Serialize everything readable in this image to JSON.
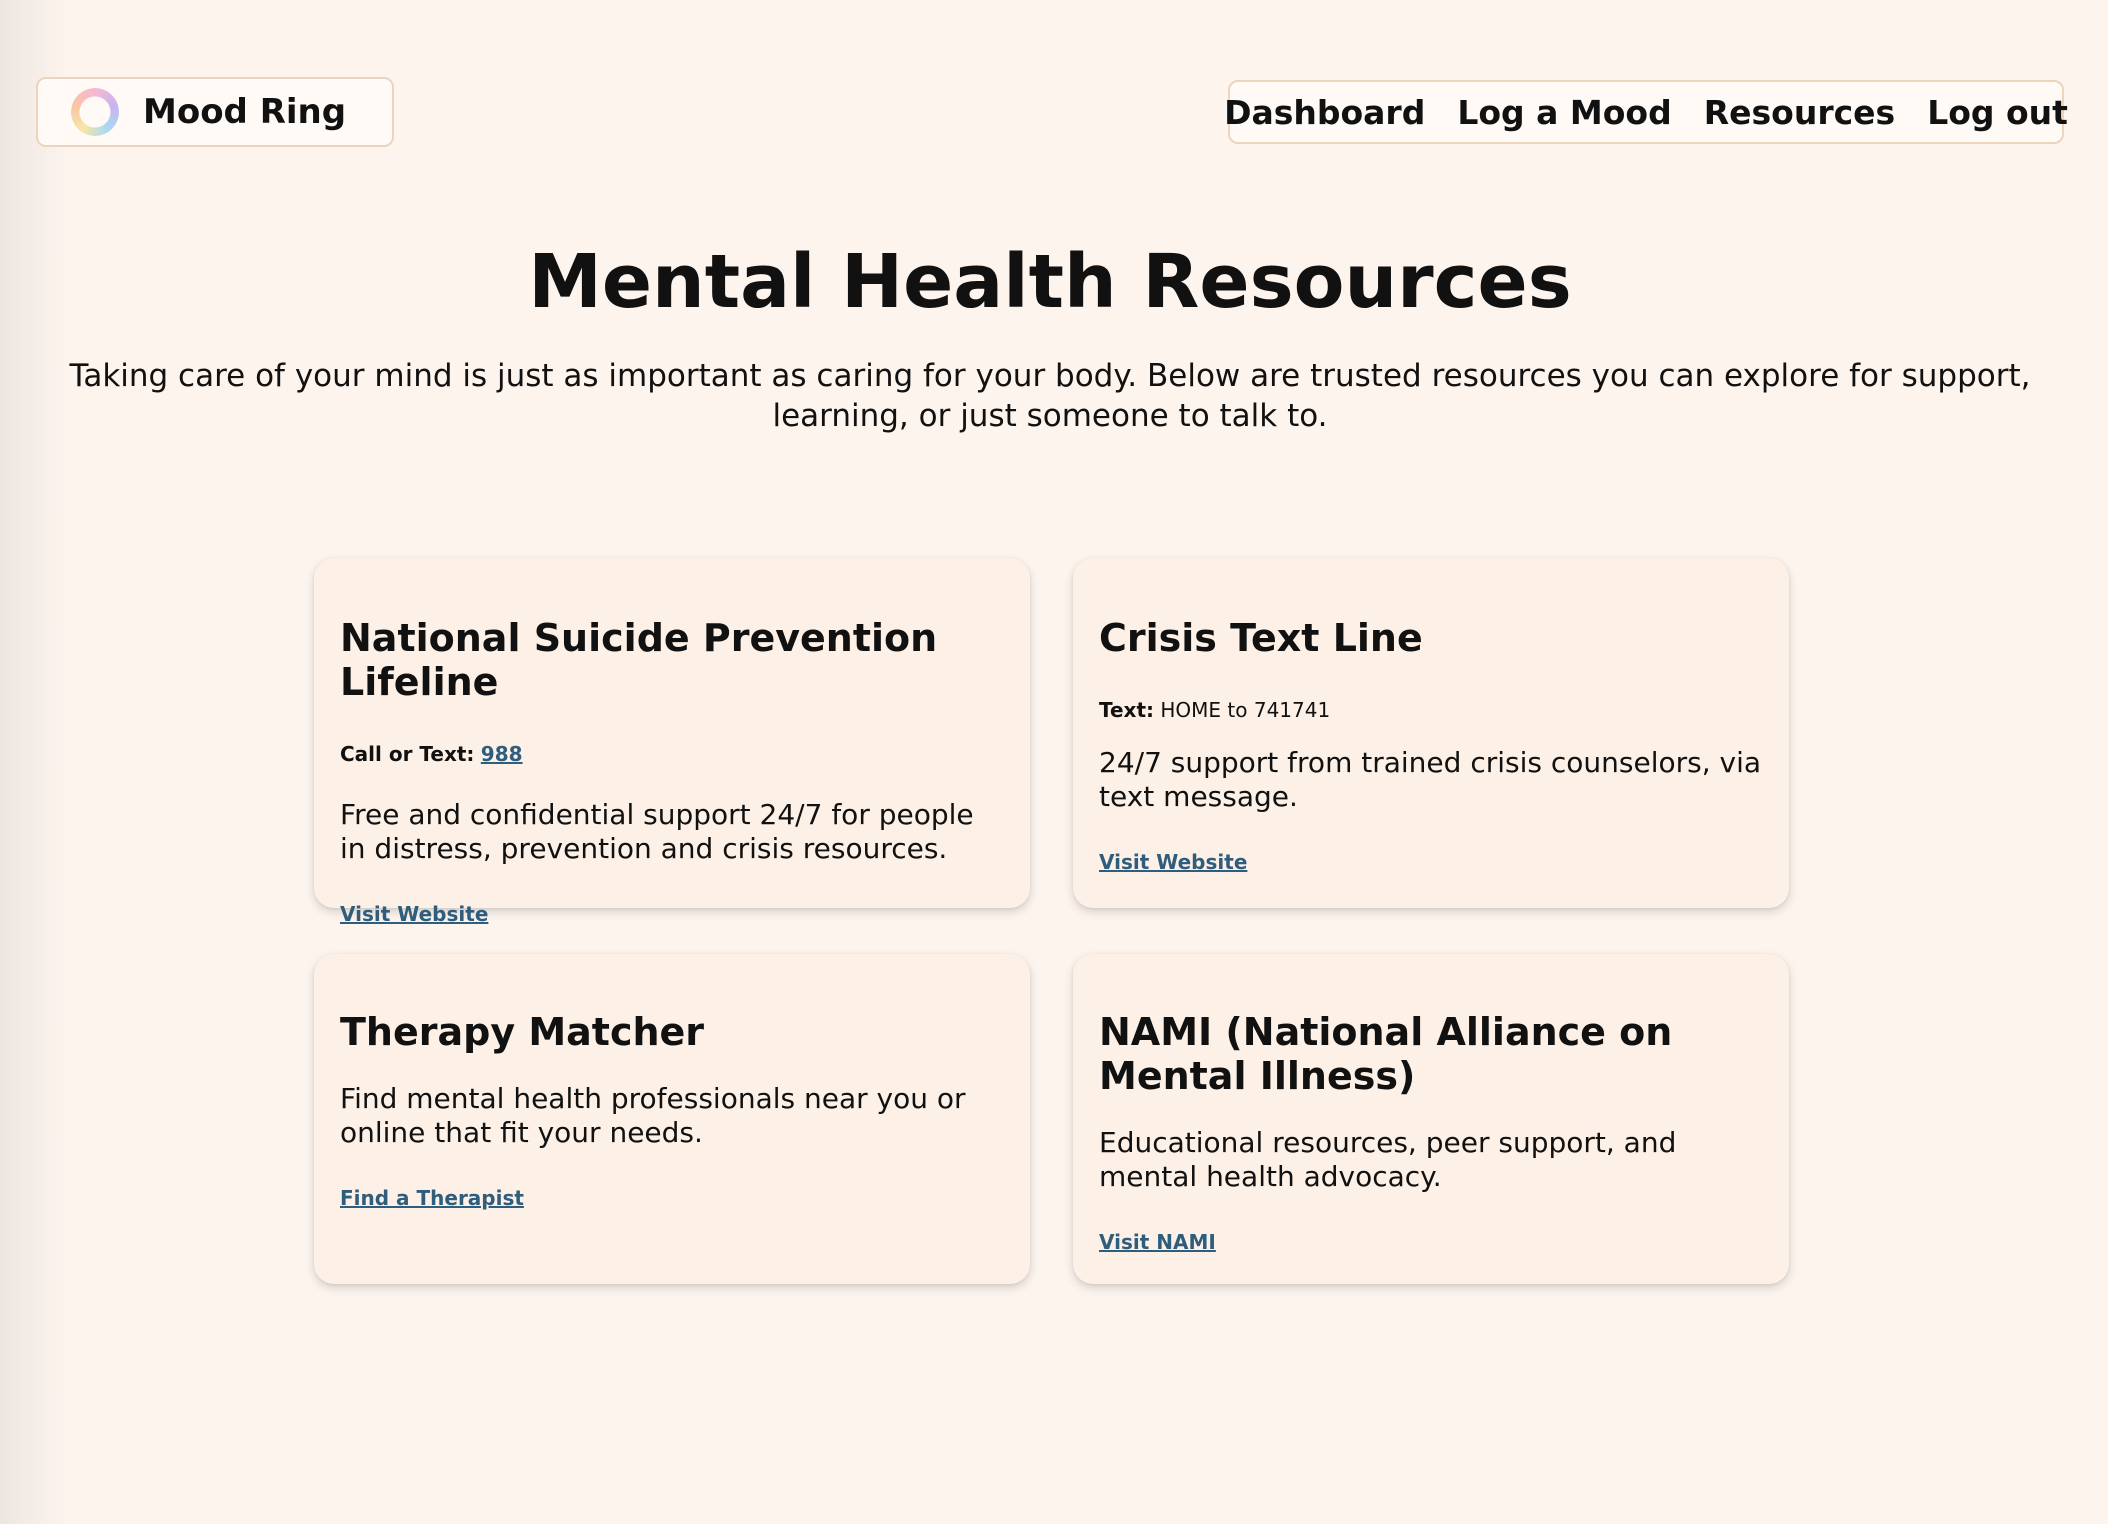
{
  "brand": {
    "logo_icon": "mood-ring-icon",
    "name": "Mood Ring"
  },
  "nav": {
    "items": [
      "Dashboard",
      "Log a Mood",
      "Resources",
      "Log out"
    ]
  },
  "hero": {
    "title": "Mental Health Resources",
    "intro": "Taking care of your mind is just as important as caring for your body. Below are trusted resources you can explore for support, learning, or just someone to talk to."
  },
  "cards": [
    {
      "title": "National Suicide Prevention Lifeline",
      "contact_label": "Call or Text:",
      "contact_value": "988",
      "description": "Free and confidential support 24/7 for people in distress, prevention and crisis resources.",
      "link_text": "Visit Website"
    },
    {
      "title": "Crisis Text Line",
      "contact_label": "Text:",
      "contact_value": "HOME to 741741",
      "description": "24/7 support from trained crisis counselors, via text message.",
      "link_text": "Visit Website"
    },
    {
      "title": "Therapy Matcher",
      "description": "Find mental health professionals near you or online that fit your needs.",
      "link_text": "Find a Therapist"
    },
    {
      "title": "NAMI (National Alliance on Mental Illness)",
      "description": "Educational resources, peer support, and mental health advocacy.",
      "link_text": "Visit NAMI"
    }
  ],
  "colors": {
    "background": "#fdf4ee",
    "card_background": "#fdf0e6",
    "border": "#ecd4bd",
    "link": "#2e5d7d"
  }
}
